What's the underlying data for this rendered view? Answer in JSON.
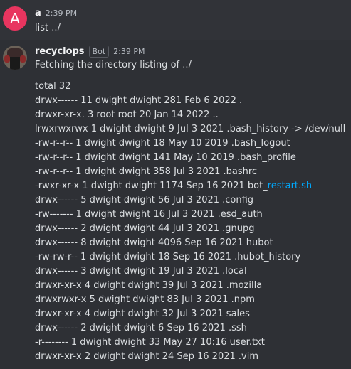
{
  "messages": [
    {
      "avatar_letter": "A",
      "avatar_color": "#e8355f",
      "author": "a",
      "time": "2:39 PM",
      "text": "list ../"
    },
    {
      "author": "recyclops",
      "badge": "Bot",
      "time": "2:39 PM",
      "text": "Fetching the directory listing of ../",
      "listing": [
        "total 32",
        "drwx------ 11 dwight dwight 281 Feb 6 2022 .",
        "drwxr-xr-x. 3 root root 20 Jan 14 2022 ..",
        "lrwxrwxrwx 1 dwight dwight 9 Jul 3 2021 .bash_history -> /dev/null",
        "-rw-r--r-- 1 dwight dwight 18 May 10 2019 .bash_logout",
        "-rw-r--r-- 1 dwight dwight 141 May 10 2019 .bash_profile",
        "-rw-r--r-- 1 dwight dwight 358 Jul 3 2021 .bashrc",
        "-rwxr-xr-x 1 dwight dwight 1174 Sep 16 2021 bot_",
        "drwx------ 5 dwight dwight 56 Jul 3 2021 .config",
        "-rw------- 1 dwight dwight 16 Jul 3 2021 .esd_auth",
        "drwx------ 2 dwight dwight 44 Jul 3 2021 .gnupg",
        "drwx------ 8 dwight dwight 4096 Sep 16 2021 hubot",
        "-rw-rw-r-- 1 dwight dwight 18 Sep 16 2021 .hubot_history",
        "drwx------ 3 dwight dwight 19 Jul 3 2021 .local",
        "drwxr-xr-x 4 dwight dwight 39 Jul 3 2021 .mozilla",
        "drwxrwxr-x 5 dwight dwight 83 Jul 3 2021 .npm",
        "drwxr-xr-x 4 dwight dwight 32 Jul 3 2021 sales",
        "drwx------ 2 dwight dwight 6 Sep 16 2021 .ssh",
        "-r-------- 1 dwight dwight 33 May 27 10:16 user.txt",
        "drwxr-xr-x 2 dwight dwight 24 Sep 16 2021 .vim"
      ],
      "link_text": "restart.sh",
      "link_color": "#00a8fc"
    }
  ]
}
